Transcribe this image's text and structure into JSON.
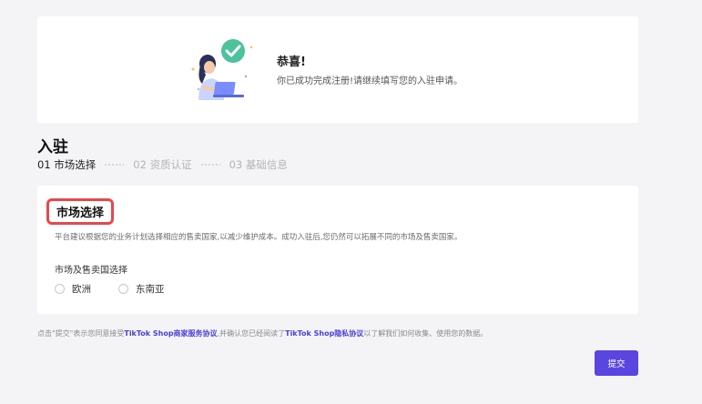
{
  "banner": {
    "title": "恭喜!",
    "description": "你已成功完成注册!请继续填写您的入驻申请。",
    "illustration_icon": "woman-laptop-success-illustration"
  },
  "page": {
    "title": "入驻"
  },
  "steps": [
    {
      "label": "01 市场选择",
      "active": true
    },
    {
      "label": "02 资质认证",
      "active": false
    },
    {
      "label": "03 基础信息",
      "active": false
    }
  ],
  "market_section": {
    "title": "市场选择",
    "description": "平台建议根据您的业务计划选择相应的售卖国家,以减少维护成本。成功入驻后,您仍然可以拓展不同的市场及售卖国家。",
    "field_label": "市场及售卖国选择",
    "options": [
      {
        "label": "欧洲",
        "selected": false
      },
      {
        "label": "东南亚",
        "selected": false
      }
    ]
  },
  "terms": {
    "prefix": "点击\"提交\"表示您同意接受",
    "link1": "TikTok Shop商家服务协议",
    "middle": ",并确认您已经阅读了",
    "link2": "TikTok Shop隐私协议",
    "suffix": "以了解我们如何收集、使用您的数据。"
  },
  "submit_label": "提交",
  "colors": {
    "accent": "#5a45e0",
    "highlight_border": "#e5484d",
    "success_green": "#4cc39a",
    "background": "#f4f4f6"
  }
}
